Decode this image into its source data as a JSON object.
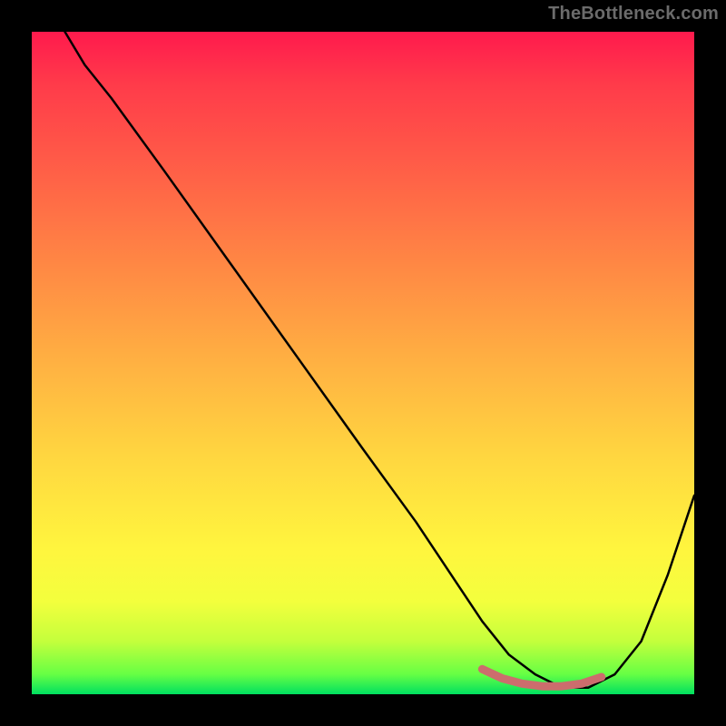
{
  "watermark": "TheBottleneck.com",
  "chart_data": {
    "type": "line",
    "title": "",
    "xlabel": "",
    "ylabel": "",
    "xlim": [
      0,
      100
    ],
    "ylim": [
      0,
      100
    ],
    "grid": false,
    "legend": false,
    "series": [
      {
        "name": "bottleneck-curve",
        "color": "#000000",
        "x": [
          5,
          8,
          12,
          20,
          30,
          40,
          50,
          58,
          64,
          68,
          72,
          76,
          80,
          84,
          88,
          92,
          96,
          100
        ],
        "y": [
          100,
          95,
          90,
          79,
          65,
          51,
          37,
          26,
          17,
          11,
          6,
          3,
          1,
          1,
          3,
          8,
          18,
          30
        ]
      },
      {
        "name": "optimal-band",
        "color": "#cc6d6d",
        "x": [
          68,
          71,
          74,
          77,
          80,
          83,
          86
        ],
        "y": [
          3.8,
          2.4,
          1.6,
          1.2,
          1.2,
          1.6,
          2.6
        ]
      }
    ],
    "gradient_stops": [
      {
        "pos": 0,
        "color": "#ff1a4d"
      },
      {
        "pos": 8,
        "color": "#ff3b4a"
      },
      {
        "pos": 22,
        "color": "#ff6247"
      },
      {
        "pos": 36,
        "color": "#ff8a44"
      },
      {
        "pos": 50,
        "color": "#ffb142"
      },
      {
        "pos": 64,
        "color": "#ffd640"
      },
      {
        "pos": 78,
        "color": "#fff53e"
      },
      {
        "pos": 86,
        "color": "#f3ff3d"
      },
      {
        "pos": 92,
        "color": "#c4ff3c"
      },
      {
        "pos": 97,
        "color": "#66ff44"
      },
      {
        "pos": 100,
        "color": "#00e060"
      }
    ]
  }
}
